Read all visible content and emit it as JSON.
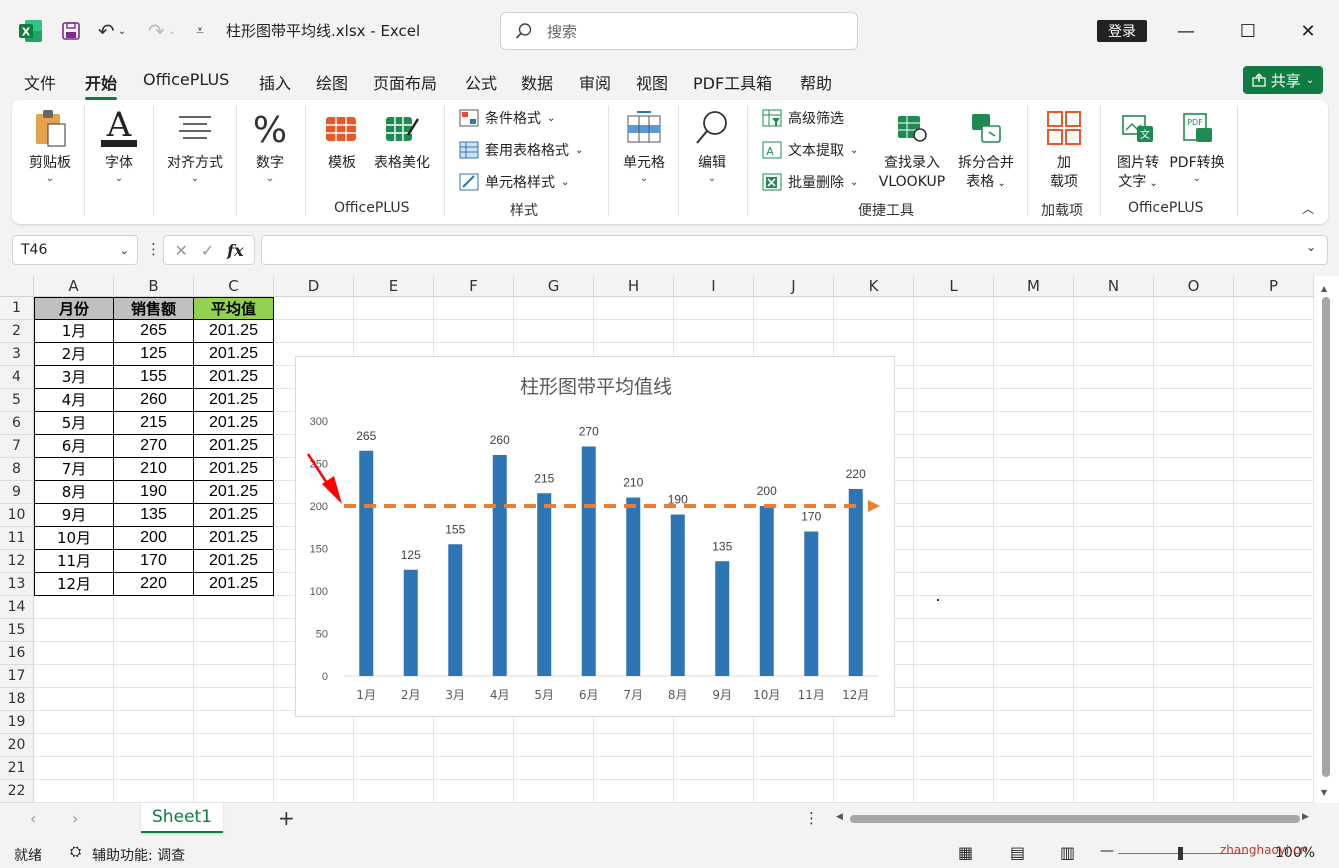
{
  "window": {
    "title": "柱形图带平均线.xlsx  -  Excel",
    "search_placeholder": "搜索",
    "login_label": "登录",
    "share_label": "共享"
  },
  "menu": {
    "tabs": [
      "文件",
      "开始",
      "OfficePLUS",
      "插入",
      "绘图",
      "页面布局",
      "公式",
      "数据",
      "审阅",
      "视图",
      "PDF工具箱",
      "帮助"
    ],
    "active": "开始"
  },
  "ribbon": {
    "clipboard": "剪贴板",
    "font": "字体",
    "align": "对齐方式",
    "number": "数字",
    "template": "模板",
    "beautify": "表格美化",
    "group_officeplus": "OfficePLUS",
    "cond_format": "条件格式",
    "table_format": "套用表格格式",
    "cell_style": "单元格样式",
    "group_style": "样式",
    "cells": "单元格",
    "edit": "编辑",
    "adv_filter": "高级筛选",
    "text_extract": "文本提取",
    "batch_delete": "批量删除",
    "vlookup_1": "查找录入",
    "vlookup_2": "VLOOKUP",
    "split_1": "拆分合并",
    "split_2": "表格",
    "group_tools": "便捷工具",
    "addin_1": "加",
    "addin_2": "载项",
    "group_addin": "加载项",
    "img2text_1": "图片转",
    "img2text_2": "文字",
    "pdf_convert": "PDF转换",
    "group_officeplus2": "OfficePLUS"
  },
  "formula_bar": {
    "name_box": "T46",
    "fx": "fx",
    "value": ""
  },
  "grid": {
    "columns": [
      "A",
      "B",
      "C",
      "D",
      "E",
      "F",
      "G",
      "H",
      "I",
      "J",
      "K",
      "L",
      "M",
      "N",
      "O",
      "P"
    ],
    "rows": [
      "1",
      "2",
      "3",
      "4",
      "5",
      "6",
      "7",
      "8",
      "9",
      "10",
      "11",
      "12",
      "13",
      "14",
      "15",
      "16",
      "17",
      "18",
      "19",
      "20",
      "21",
      "22"
    ],
    "table_headers": [
      "月份",
      "销售额",
      "平均值"
    ],
    "table_rows": [
      [
        "1月",
        "265",
        "201.25"
      ],
      [
        "2月",
        "125",
        "201.25"
      ],
      [
        "3月",
        "155",
        "201.25"
      ],
      [
        "4月",
        "260",
        "201.25"
      ],
      [
        "5月",
        "215",
        "201.25"
      ],
      [
        "6月",
        "270",
        "201.25"
      ],
      [
        "7月",
        "210",
        "201.25"
      ],
      [
        "8月",
        "190",
        "201.25"
      ],
      [
        "9月",
        "135",
        "201.25"
      ],
      [
        "10月",
        "200",
        "201.25"
      ],
      [
        "11月",
        "170",
        "201.25"
      ],
      [
        "12月",
        "220",
        "201.25"
      ]
    ]
  },
  "chart_data": {
    "type": "bar",
    "title": "柱形图带平均值线",
    "categories": [
      "1月",
      "2月",
      "3月",
      "4月",
      "5月",
      "6月",
      "7月",
      "8月",
      "9月",
      "10月",
      "11月",
      "12月"
    ],
    "values": [
      265,
      125,
      155,
      260,
      215,
      270,
      210,
      190,
      135,
      200,
      170,
      220
    ],
    "average": 201.25,
    "yticks": [
      "0",
      "50",
      "100",
      "150",
      "200",
      "250",
      "300"
    ],
    "ylim": [
      0,
      300
    ],
    "bar_color": "#2e75b6",
    "avg_line_color": "#ed7d31",
    "arrow_color": "#ff0000",
    "grid": false
  },
  "sheets": {
    "tabs": [
      "Sheet1"
    ],
    "add_label": "+"
  },
  "status": {
    "ready": "就绪",
    "accessibility": "辅助功能: 调查",
    "zoom": "100%",
    "watermark": "zhanghaoyi.cn"
  },
  "colors": {
    "accent": "#107c41",
    "header_gray": "#bfbfbf",
    "header_green": "#92d050"
  }
}
